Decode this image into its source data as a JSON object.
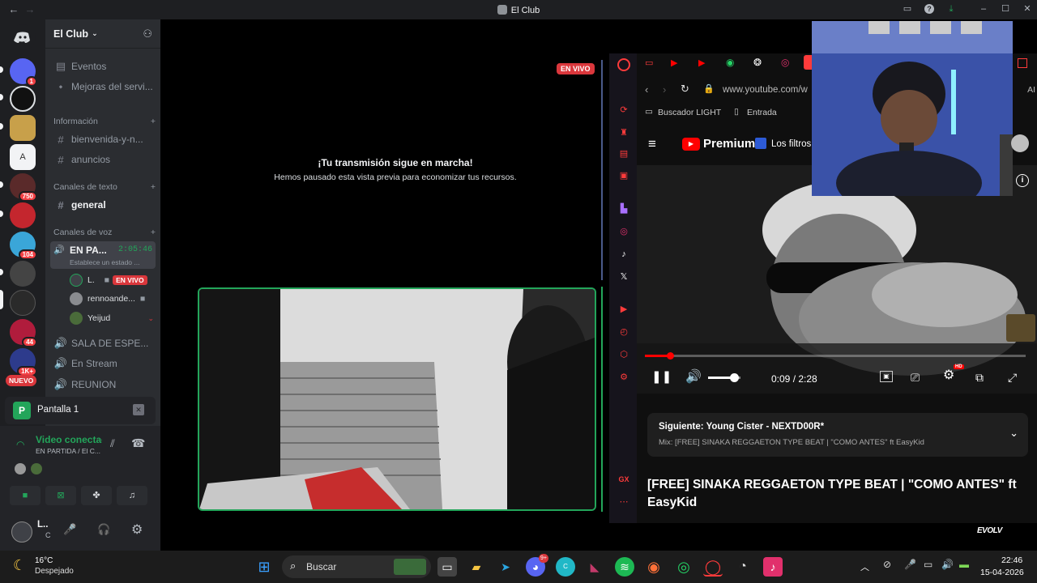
{
  "window": {
    "title": "El Club",
    "back": "←",
    "forward": "→"
  },
  "server": {
    "name": "El Club"
  },
  "rail": {
    "badges": [
      "1",
      "750",
      "104",
      "44",
      "1K+",
      "NUEVO"
    ]
  },
  "channels": {
    "events": "Eventos",
    "boosts": "Mejoras del servi...",
    "cat_info": "Información",
    "ch_welcome": "bienvenida-y-n...",
    "ch_announce": "anuncios",
    "cat_text": "Canales de texto",
    "ch_general": "general",
    "cat_voice": "Canales de voz",
    "voice_active": "EN PA...",
    "voice_time": "2:05:46",
    "voice_status": "Establece un estado ...",
    "user1": "L.",
    "user1_live": "EN VIVO",
    "user2": "rennoande...",
    "user3": "Yeijud",
    "ch_waiting": "SALA DE ESPE...",
    "ch_stream": "En Stream",
    "ch_meeting": "REUNION"
  },
  "screen_panel": {
    "label": "Pantalla 1",
    "avatar_letter": "P"
  },
  "voice_panel": {
    "status": "Video conectad",
    "detail": "EN PARTIDA / El C..."
  },
  "user_panel": {
    "name": "L..",
    "status": "C"
  },
  "stage": {
    "live_badge": "EN VIVO",
    "paused_title": "¡Tu transmisión sigue en marcha!",
    "paused_sub": "Hemos pausado esta vista previa para economizar tus recursos."
  },
  "browser": {
    "url": "www.youtube.com/w",
    "bookmark1": "Buscador LIGHT",
    "bookmark2": "Entrada",
    "yt_brand": "Premium",
    "yt_filter": "Los filtros",
    "ai_label": "AI",
    "time": "0:09 / 2:28",
    "progress": 0.065,
    "volume": 0.8,
    "next_label": "Siguiente: Young Cister - NEXTD00R*",
    "mix_label": "Mix: [FREE] SINAKA REGGAETON TYPE BEAT | \"COMO ANTES\" ft EasyKid",
    "video_title": "[FREE] SINAKA REGGAETON TYPE BEAT | \"COMO ANTES\" ft EasyKid",
    "hd": "HD",
    "gx": "GX"
  },
  "taskbar": {
    "temp": "16°C",
    "weather": "Despejado",
    "search": "Buscar",
    "time": "22:46",
    "date": "15-04-2026",
    "discord_badge": "9+"
  },
  "watermark": "EVOLV"
}
